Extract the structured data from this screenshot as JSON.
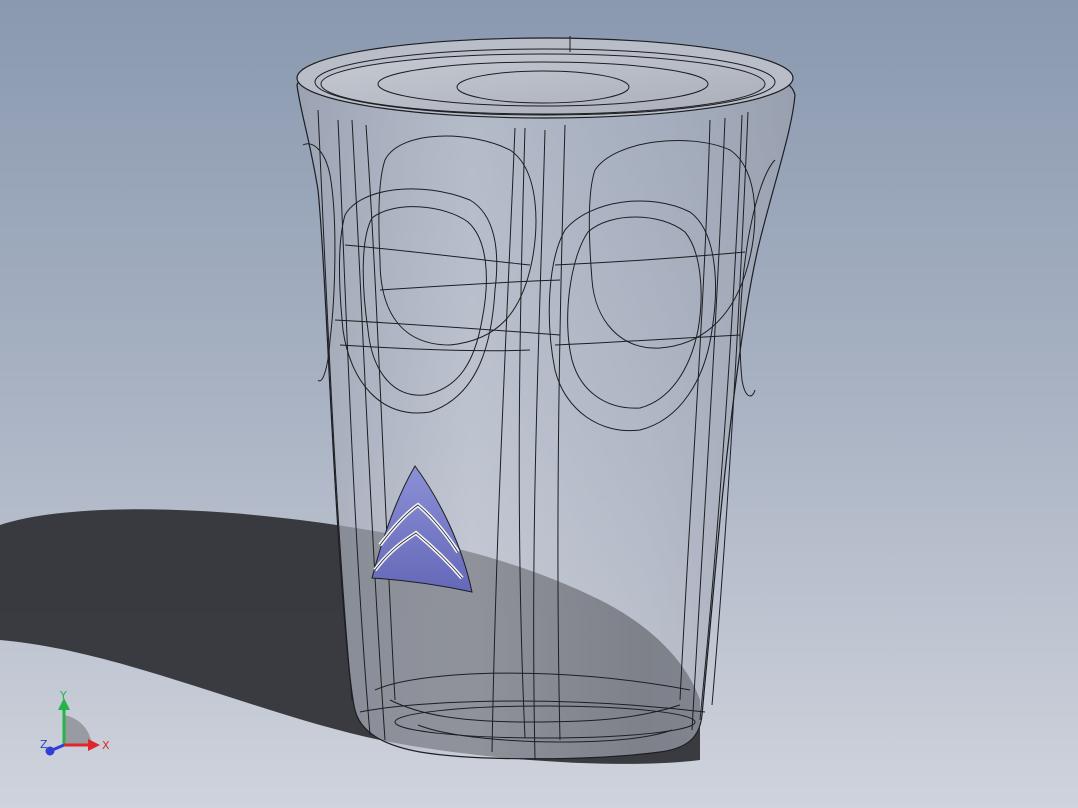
{
  "viewport": {
    "background_top": "#8b9ab0",
    "background_mid": "#aeb7c7",
    "background_bottom": "#c9ced8",
    "shadow_color": "#2a2b2e"
  },
  "model": {
    "name": "",
    "fill_color": "#b7bcc6",
    "edge_color": "#1c1e22",
    "logo_color": "#6f73c2"
  },
  "triad": {
    "x_label": "X",
    "y_label": "Y",
    "z_label": "Z",
    "x_color": "#e0262b",
    "y_color": "#25b34a",
    "z_color": "#2f3fd6"
  }
}
